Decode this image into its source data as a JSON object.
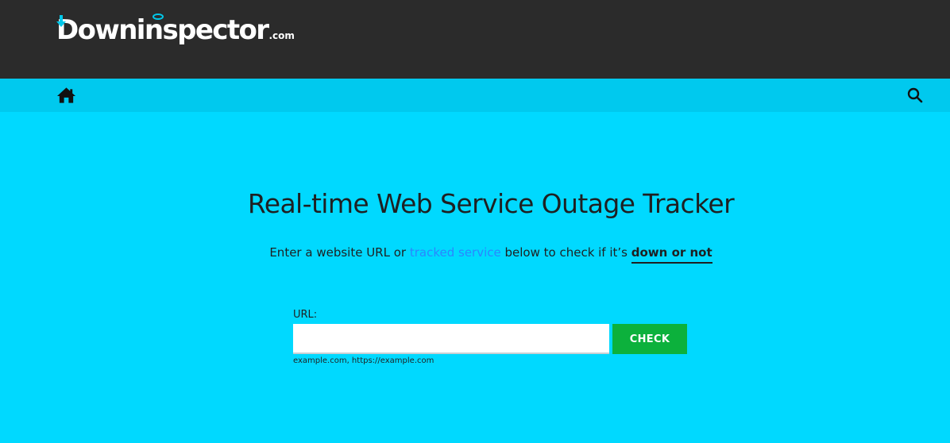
{
  "header": {
    "logo_text": "Downinspector",
    "logo_suffix": ".com"
  },
  "nav": {
    "home_icon": "home-icon",
    "search_icon": "search-icon"
  },
  "hero": {
    "title": "Real-time Web Service Outage Tracker",
    "sub_before": "Enter a website URL or ",
    "sub_link": "tracked service",
    "sub_middle": " below to check if it’s ",
    "sub_emphasis": "down or not"
  },
  "form": {
    "url_label": "URL:",
    "url_value": "",
    "check_label": "CHECK",
    "hint": "example.com, https://example.com"
  },
  "colors": {
    "topbar": "#2b2b2b",
    "navbar": "#00c9ee",
    "background": "#00d9ff",
    "link": "#2a86ff",
    "button": "#0cb13c"
  }
}
